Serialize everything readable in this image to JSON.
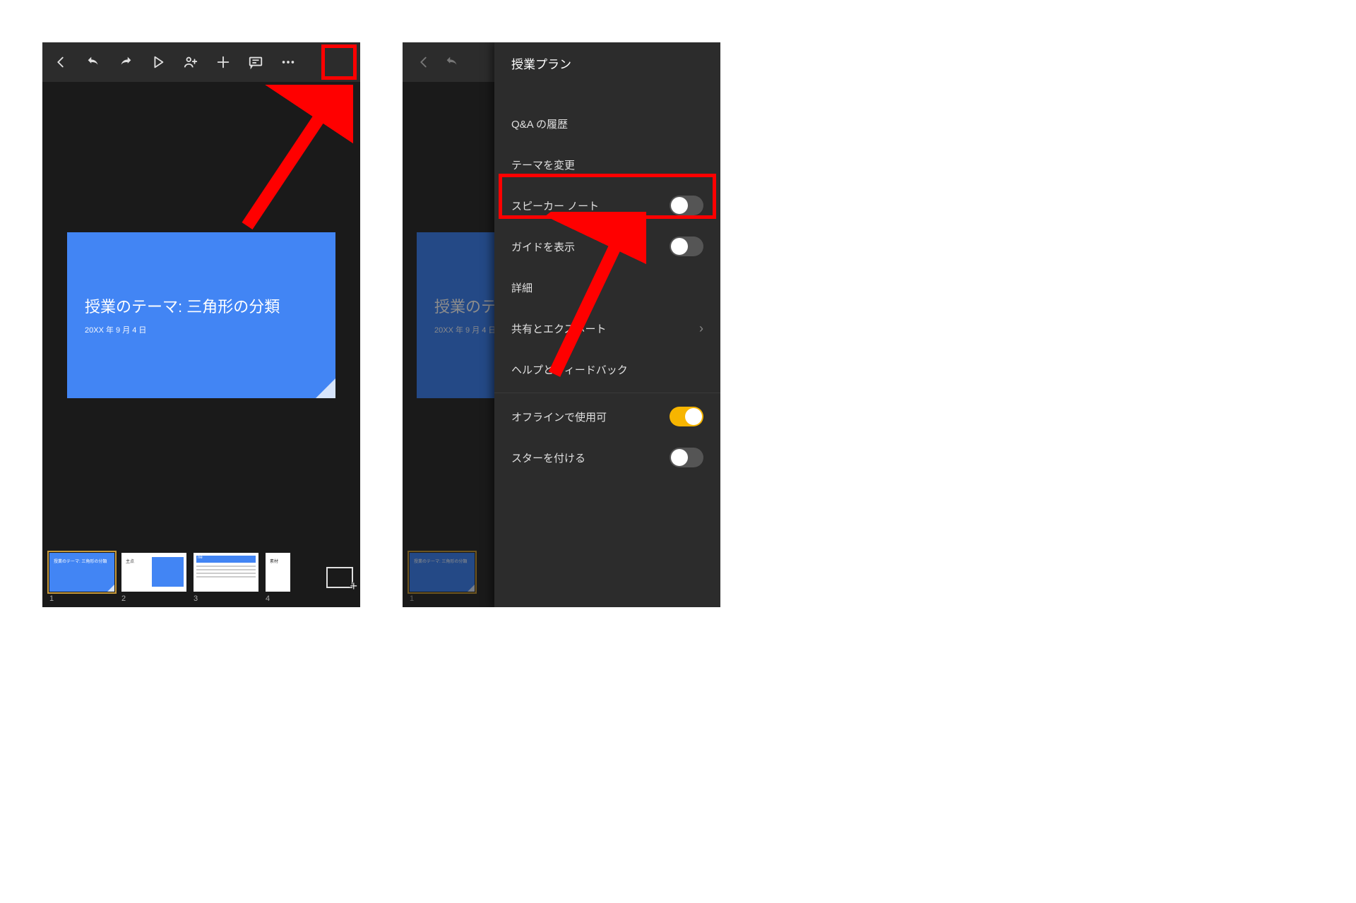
{
  "left": {
    "toolbar": {
      "back_icon": "back",
      "undo_icon": "undo",
      "redo_icon": "redo",
      "play_icon": "play",
      "share_icon": "share",
      "plus_icon": "plus",
      "comment_icon": "comment",
      "more_icon": "more"
    },
    "slide": {
      "title": "授業のテーマ: 三角形の分類",
      "date": "20XX 年 9 月 4 日"
    },
    "thumbs": {
      "t1": {
        "num": "1",
        "text": "授業のテーマ: 三角形の分類"
      },
      "t2": {
        "num": "2",
        "text": "主点"
      },
      "t3": {
        "num": "3",
        "text": "ne"
      },
      "t4": {
        "num": "4",
        "text": "素材"
      }
    }
  },
  "right": {
    "menu": {
      "title": "授業プラン",
      "qa_history": "Q&A の履歴",
      "change_theme": "テーマを変更",
      "speaker_note": "スピーカー ノート",
      "show_guide": "ガイドを表示",
      "details": "詳細",
      "share_export": "共有とエクスポート",
      "help_feedback": "ヘルプとフィードバック",
      "offline": "オフラインで使用可",
      "star": "スターを付ける"
    },
    "slide": {
      "title": "授業のテ",
      "date": "20XX 年 9 月 4 日"
    },
    "thumbs": {
      "t1": {
        "num": "1",
        "text": "授業のテーマ: 三角形の分類"
      }
    }
  }
}
